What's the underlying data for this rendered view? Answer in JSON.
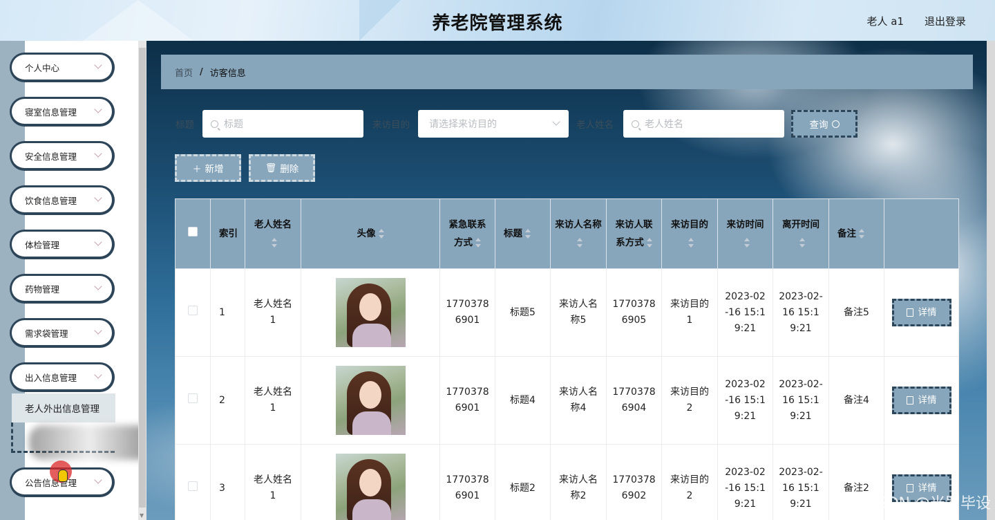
{
  "header": {
    "title": "养老院管理系统",
    "user": "老人 a1",
    "logout": "退出登录"
  },
  "sidebar": {
    "items": [
      {
        "label": "个人中心"
      },
      {
        "label": "寝室信息管理"
      },
      {
        "label": "安全信息管理"
      },
      {
        "label": "饮食信息管理"
      },
      {
        "label": "体检管理"
      },
      {
        "label": "药物管理"
      },
      {
        "label": "需求袋管理"
      },
      {
        "label": "出入信息管理"
      },
      {
        "label": "公告信息管理"
      }
    ],
    "submenu": {
      "label": "老人外出信息管理"
    }
  },
  "breadcrumb": {
    "home": "首页",
    "separator": "/",
    "current": "访客信息"
  },
  "filters": {
    "title_label": "标题",
    "title_placeholder": "标题",
    "purpose_label": "来访目的",
    "purpose_placeholder": "请选择来访目的",
    "elder_label": "老人姓名",
    "elder_placeholder": "老人姓名",
    "query_button": "查询"
  },
  "actions": {
    "add": "新增",
    "delete": "删除"
  },
  "table": {
    "headers": {
      "index": "索引",
      "elder_name": "老人姓名",
      "avatar": "头像",
      "emergency_phone": "紧急联系方式",
      "title": "标题",
      "visitor_name": "来访人名称",
      "visitor_phone": "来访人联系方式",
      "purpose": "来访目的",
      "visit_time": "来访时间",
      "leave_time": "离开时间",
      "remark": "备注"
    },
    "detail_label": "详情",
    "rows": [
      {
        "index": "1",
        "elder_name": "老人姓名1",
        "emergency_phone": "17703786901",
        "title": "标题5",
        "visitor_name": "来访人名称5",
        "visitor_phone": "17703786905",
        "purpose": "来访目的1",
        "visit_time": "2023-02-16 15:19:21",
        "leave_time": "2023-02-16 15:19:21",
        "remark": "备注5"
      },
      {
        "index": "2",
        "elder_name": "老人姓名1",
        "emergency_phone": "17703786901",
        "title": "标题4",
        "visitor_name": "来访人名称4",
        "visitor_phone": "17703786904",
        "purpose": "来访目的2",
        "visit_time": "2023-02-16 15:19:21",
        "leave_time": "2023-02-16 15:19:21",
        "remark": "备注4"
      },
      {
        "index": "3",
        "elder_name": "老人姓名1",
        "emergency_phone": "17703786901",
        "title": "标题2",
        "visitor_name": "来访人名称2",
        "visitor_phone": "17703786902",
        "purpose": "来访目的2",
        "visit_time": "2023-02-16 15:19:21",
        "leave_time": "2023-02-16 15:19:21",
        "remark": "备注2"
      }
    ]
  },
  "watermark": "CSDN @米罗毕设",
  "colors": {
    "accent": "#87a6bc",
    "dark_border": "#2c4558",
    "sidebar_stripe": "#9cb2c0"
  }
}
